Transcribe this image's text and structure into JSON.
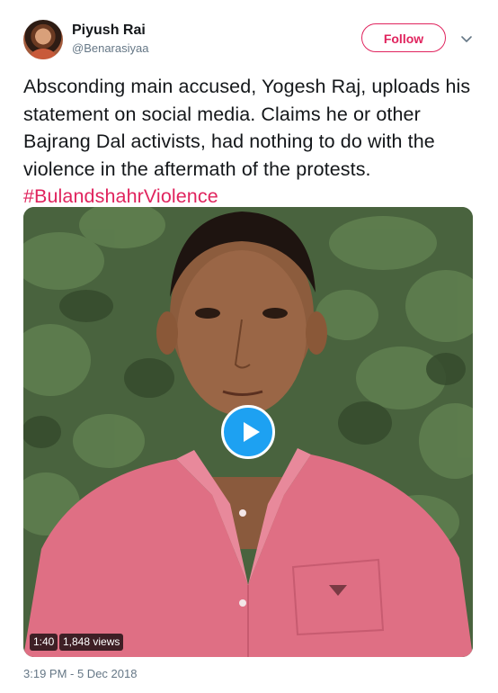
{
  "user": {
    "display_name": "Piyush Rai",
    "handle": "@Benarasiyaa",
    "avatar_icon": "user-avatar"
  },
  "actions": {
    "follow_label": "Follow",
    "more_icon": "chevron-down-icon"
  },
  "tweet": {
    "text": "Absconding main accused, Yogesh Raj, uploads his statement on social media. Claims he or other Bajrang Dal activists, had nothing to do with the violence in the aftermath of the protests. ",
    "hashtag": "#BulandshahrViolence"
  },
  "video": {
    "duration": "1:40",
    "views": "1,848 views",
    "play_icon": "play-icon"
  },
  "meta": {
    "timestamp": "3:19 PM - 5 Dec 2018"
  },
  "colors": {
    "accent": "#e0245e",
    "play_button": "#1da1f2",
    "secondary_text": "#657786"
  }
}
